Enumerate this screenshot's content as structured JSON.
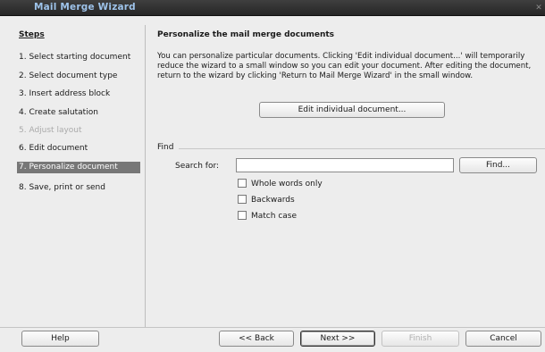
{
  "window": {
    "title": "Mail Merge Wizard",
    "close_glyph": "✕"
  },
  "steps": {
    "title": "Steps",
    "items": [
      {
        "label": "1. Select starting document"
      },
      {
        "label": "2. Select document type"
      },
      {
        "label": "3. Insert address block"
      },
      {
        "label": "4. Create salutation"
      },
      {
        "label": "5. Adjust layout",
        "state": "disabled"
      },
      {
        "label": "6. Edit document"
      },
      {
        "label": "7. Personalize document",
        "state": "selected"
      },
      {
        "label": "8. Save, print or send"
      }
    ]
  },
  "main": {
    "title": "Personalize the mail merge documents",
    "description": "You can personalize particular documents. Clicking 'Edit individual document...' will temporarily reduce the wizard to a small window so you can edit your document. After editing the document, return to the wizard by clicking 'Return to Mail Merge Wizard' in the small window.",
    "edit_button_label": "Edit individual document...",
    "find": {
      "section_label": "Find",
      "search_label": "Search for:",
      "search_value": "",
      "find_button_label": "Find...",
      "options": [
        {
          "label": "Whole words only",
          "checked": false
        },
        {
          "label": "Backwards",
          "checked": false
        },
        {
          "label": "Match case",
          "checked": false
        }
      ]
    }
  },
  "footer": {
    "help_label": "Help",
    "back_label": "<< Back",
    "next_label": "Next >>",
    "finish_label": "Finish",
    "cancel_label": "Cancel"
  },
  "colors": {
    "titlebar_bg": "#2f2f2f",
    "title_text": "#9ec3ea",
    "selected_step_bg": "#777777",
    "disabled_text": "#aaaaaa"
  }
}
